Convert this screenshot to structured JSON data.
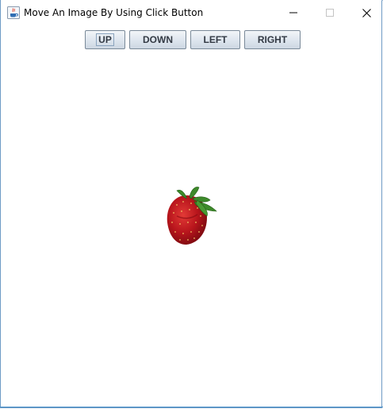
{
  "window": {
    "title": "Move An Image By Using Click Button",
    "accent_color": "#4a90c8"
  },
  "icons": {
    "app": "java-coffee-cup-icon",
    "minimize": "minimize-icon",
    "maximize": "maximize-icon",
    "close": "close-icon",
    "image": "strawberry-image"
  },
  "toolbar": {
    "buttons": [
      {
        "label": "UP",
        "focused": true
      },
      {
        "label": "DOWN",
        "focused": false
      },
      {
        "label": "LEFT",
        "focused": false
      },
      {
        "label": "RIGHT",
        "focused": false
      }
    ]
  }
}
